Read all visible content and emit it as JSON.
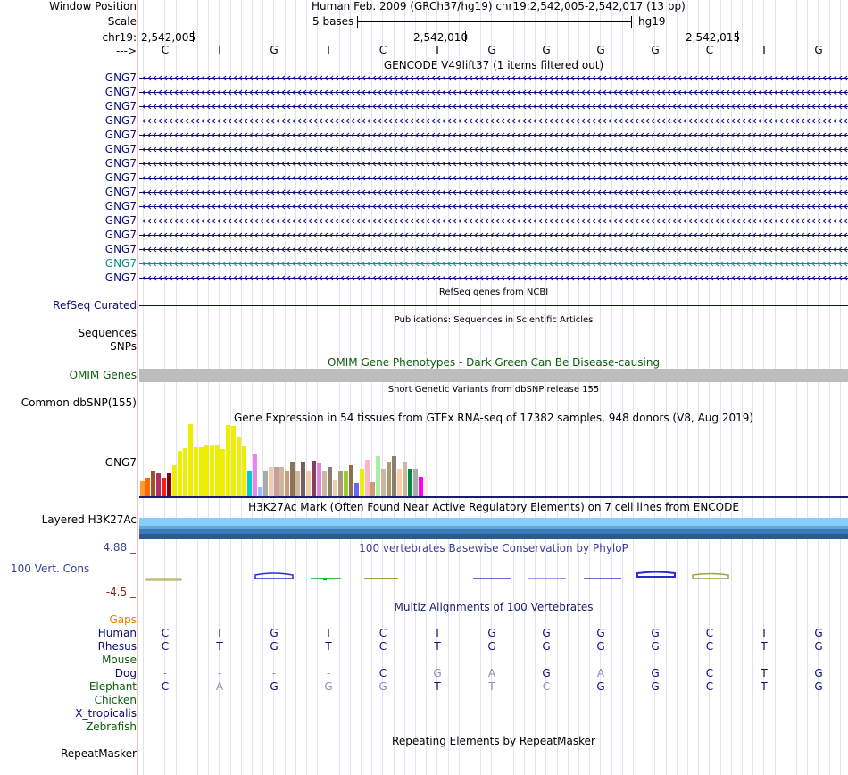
{
  "header": {
    "window_position_label": "Window Position",
    "position_text": "Human Feb. 2009 (GRCh37/hg19)   chr19:2,542,005-2,542,017 (13 bp)",
    "scale_label": "Scale",
    "scale_text": "5 bases",
    "scale_assembly": "hg19",
    "chrom_label": "chr19:",
    "coord_1": "2,542,005",
    "coord_2": "2,542,010",
    "coord_3": "2,542,015",
    "strand_label": "--->",
    "bases": [
      "C",
      "T",
      "G",
      "T",
      "C",
      "T",
      "G",
      "G",
      "G",
      "G",
      "C",
      "T",
      "G"
    ]
  },
  "gencode": {
    "title": "GENCODE V49lift37 (1 items filtered out)",
    "genes": [
      "GNG7",
      "GNG7",
      "GNG7",
      "GNG7",
      "GNG7",
      "GNG7",
      "GNG7",
      "GNG7",
      "GNG7",
      "GNG7",
      "GNG7",
      "GNG7",
      "GNG7",
      "GNG7",
      "GNG7"
    ],
    "colors": [
      "#0c0c78",
      "#0c0c78",
      "#0c0c78",
      "#0c0c78",
      "#0c0c78",
      "#0c0c78",
      "#0c0c78",
      "#0c0c78",
      "#0c0c78",
      "#0c0c78",
      "#0c0c78",
      "#0c0c78",
      "#0c0c78",
      "#0c8c8c",
      "#0c0c78"
    ]
  },
  "refseq": {
    "title": "RefSeq genes from NCBI",
    "label": "RefSeq Curated",
    "color": "#0c0c78"
  },
  "publications": {
    "title": "Publications: Sequences in Scientific Articles",
    "label_1": "Sequences",
    "label_2": "SNPs"
  },
  "omim": {
    "title": "OMIM Gene Phenotypes - Dark Green Can Be Disease-causing",
    "label": "OMIM Genes",
    "color": "#0c5c0c"
  },
  "dbsnp": {
    "title": "Short Genetic Variants from dbSNP release 155",
    "label": "Common dbSNP(155)"
  },
  "gtex": {
    "title": "Gene Expression in 54 tissues from GTEx RNA-seq of 17382 samples, 948 donors (V8, Aug 2019)",
    "label": "GNG7",
    "bars": [
      {
        "v": 0.2,
        "c": "#ff9933"
      },
      {
        "v": 0.25,
        "c": "#ff6600"
      },
      {
        "v": 0.34,
        "c": "#a0522d"
      },
      {
        "v": 0.31,
        "c": "#b03060"
      },
      {
        "v": 0.25,
        "c": "#ff1a1a"
      },
      {
        "v": 0.31,
        "c": "#880000"
      },
      {
        "v": 0.43,
        "c": "#eeee00"
      },
      {
        "v": 0.63,
        "c": "#eeee00"
      },
      {
        "v": 0.66,
        "c": "#eeee00"
      },
      {
        "v": 1.0,
        "c": "#eeee00"
      },
      {
        "v": 0.68,
        "c": "#eeee00"
      },
      {
        "v": 0.68,
        "c": "#eeee00"
      },
      {
        "v": 0.71,
        "c": "#eeee00"
      },
      {
        "v": 0.71,
        "c": "#eeee00"
      },
      {
        "v": 0.71,
        "c": "#eeee00"
      },
      {
        "v": 0.65,
        "c": "#eeee00"
      },
      {
        "v": 0.99,
        "c": "#eeee00"
      },
      {
        "v": 0.97,
        "c": "#eeee00"
      },
      {
        "v": 0.83,
        "c": "#eeee00"
      },
      {
        "v": 0.7,
        "c": "#eeee00"
      },
      {
        "v": 0.34,
        "c": "#00cccc"
      },
      {
        "v": 0.57,
        "c": "#ee82ee"
      },
      {
        "v": 0.12,
        "c": "#99bbff"
      },
      {
        "v": 0.34,
        "c": "#aaaaaa"
      },
      {
        "v": 0.4,
        "c": "#eecbad"
      },
      {
        "v": 0.4,
        "c": "#cd9b9b"
      },
      {
        "v": 0.4,
        "c": "#cdb79e"
      },
      {
        "v": 0.35,
        "c": "#cd9b77"
      },
      {
        "v": 0.47,
        "c": "#8b7355"
      },
      {
        "v": 0.35,
        "c": "#cdb79e"
      },
      {
        "v": 0.47,
        "c": "#7a5c5c"
      },
      {
        "v": 0.35,
        "c": "#eecbad"
      },
      {
        "v": 0.49,
        "c": "#8b3a62"
      },
      {
        "v": 0.45,
        "c": "#dd88dd"
      },
      {
        "v": 0.35,
        "c": "#cdb79e"
      },
      {
        "v": 0.4,
        "c": "#8b7d6b"
      },
      {
        "v": 0.21,
        "c": "#eecbad"
      },
      {
        "v": 0.35,
        "c": "#aa9977"
      },
      {
        "v": 0.35,
        "c": "#99cc33"
      },
      {
        "v": 0.42,
        "c": "#8b6f4e"
      },
      {
        "v": 0.17,
        "c": "#6666ff"
      },
      {
        "v": 0.38,
        "c": "#eeee00"
      },
      {
        "v": 0.5,
        "c": "#ffb6c1"
      },
      {
        "v": 0.19,
        "c": "#cd9b77"
      },
      {
        "v": 0.55,
        "c": "#aaeeaa"
      },
      {
        "v": 0.38,
        "c": "#cdb79e"
      },
      {
        "v": 0.47,
        "c": "#aa9977"
      },
      {
        "v": 0.55,
        "c": "#8b7d6b"
      },
      {
        "v": 0.38,
        "c": "#ffccaa"
      },
      {
        "v": 0.47,
        "c": "#cdb79e"
      },
      {
        "v": 0.38,
        "c": "#008844"
      },
      {
        "v": 0.38,
        "c": "#aaaaaa"
      },
      {
        "v": 0.26,
        "c": "#ff00ff"
      },
      {
        "v": 0.28,
        "c": "#eeeeee"
      }
    ]
  },
  "h3k27ac": {
    "title": "H3K27Ac Mark (Often Found Near Active Regulatory Elements) on 7 cell lines from ENCODE",
    "label": "Layered H3K27Ac",
    "colors": [
      "#87cefa",
      "#5fa8d8",
      "#3a7ab8",
      "#2a5a90"
    ]
  },
  "phylop": {
    "title": "100 vertebrates Basewise Conservation by PhyloP",
    "label": "100 Vert. Cons",
    "max": "4.88 _",
    "min": "-4.5 _",
    "title_color": "#3c3c9c"
  },
  "multiz": {
    "title": "Multiz Alignments of 100 Vertebrates",
    "title_color": "#1c1c6c",
    "gaps_label": "Gaps",
    "species": [
      {
        "name": "Human",
        "color": "#0c0c78",
        "bases": [
          "C",
          "T",
          "G",
          "T",
          "C",
          "T",
          "G",
          "G",
          "G",
          "G",
          "C",
          "T",
          "G"
        ]
      },
      {
        "name": "Rhesus",
        "color": "#0c0c78",
        "bases": [
          "C",
          "T",
          "G",
          "T",
          "C",
          "T",
          "G",
          "G",
          "G",
          "G",
          "C",
          "T",
          "G"
        ]
      },
      {
        "name": "Mouse",
        "color": "#0c5c0c",
        "bases": [
          "",
          "",
          "",
          "",
          "",
          "",
          "",
          "",
          "",
          "",
          "",
          "",
          ""
        ]
      },
      {
        "name": "Dog",
        "color": "#0c0c78",
        "bases": [
          "-",
          "-",
          "-",
          "-",
          "C",
          "G",
          "A",
          "G",
          "A",
          "G",
          "C",
          "T",
          "G"
        ]
      },
      {
        "name": "Elephant",
        "color": "#0c5c0c",
        "bases": [
          "C",
          "A",
          "G",
          "G",
          "G",
          "T",
          "T",
          "C",
          "G",
          "G",
          "C",
          "T",
          "G"
        ]
      },
      {
        "name": "Chicken",
        "color": "#0c5c0c",
        "bases": [
          "",
          "",
          "",
          "",
          "",
          "",
          "",
          "",
          "",
          "",
          "",
          "",
          ""
        ]
      },
      {
        "name": "X_tropicalis",
        "color": "#0c0c78",
        "bases": [
          "",
          "",
          "",
          "",
          "",
          "",
          "",
          "",
          "",
          "",
          "",
          "",
          ""
        ]
      },
      {
        "name": "Zebrafish",
        "color": "#0c5c0c",
        "bases": [
          "",
          "",
          "",
          "",
          "",
          "",
          "",
          "",
          "",
          "",
          "",
          "",
          ""
        ]
      }
    ]
  },
  "repeatmasker": {
    "title": "Repeating Elements by RepeatMasker",
    "label": "RepeatMasker"
  }
}
